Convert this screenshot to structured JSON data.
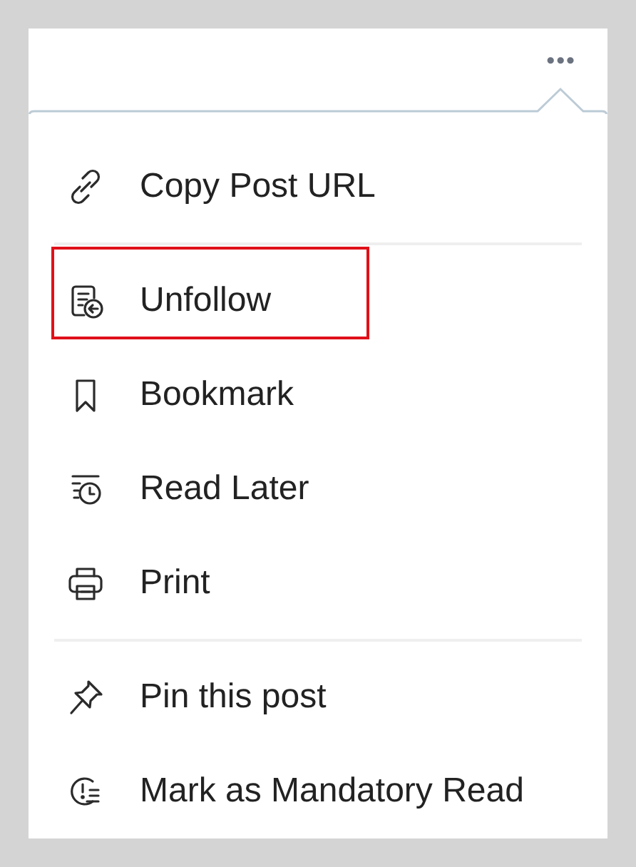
{
  "more_button": {
    "label": "•••"
  },
  "menu": {
    "groups": [
      {
        "items": [
          {
            "label": "Copy Post URL",
            "highlighted": false
          }
        ]
      },
      {
        "items": [
          {
            "label": "Unfollow",
            "highlighted": true
          },
          {
            "label": "Bookmark",
            "highlighted": false
          },
          {
            "label": "Read Later",
            "highlighted": false
          },
          {
            "label": "Print",
            "highlighted": false
          }
        ]
      },
      {
        "items": [
          {
            "label": "Pin this post",
            "highlighted": false
          },
          {
            "label": "Mark as Mandatory Read",
            "highlighted": false
          }
        ]
      }
    ]
  }
}
